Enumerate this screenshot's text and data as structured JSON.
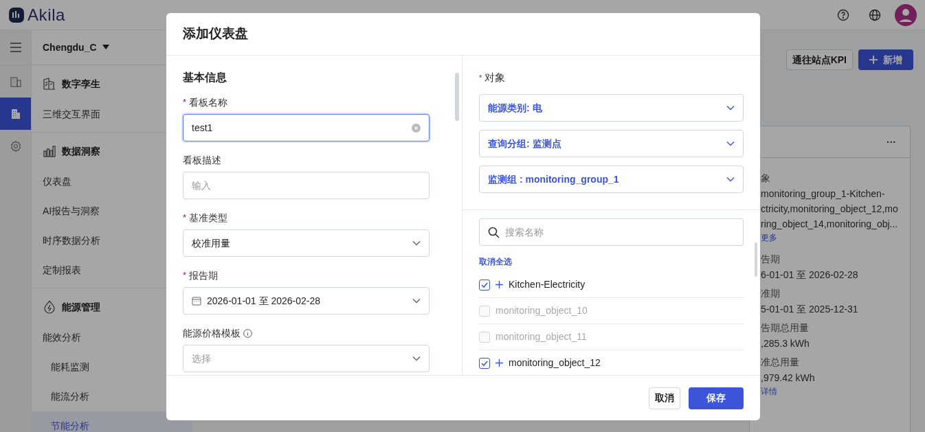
{
  "header": {
    "logo": "Akila"
  },
  "rail_items": [
    {
      "kind": "building",
      "selected": false
    },
    {
      "kind": "office",
      "selected": true
    },
    {
      "kind": "settings",
      "selected": false
    }
  ],
  "sidebar": {
    "site": "Chengdu_C",
    "groups": [
      {
        "title": "数字孪生",
        "kind": "twin",
        "items": [
          {
            "label": "三维交互界面",
            "selected": false
          }
        ]
      },
      {
        "title": "数据洞察",
        "kind": "chart",
        "items": [
          {
            "label": "仪表盘",
            "selected": false
          },
          {
            "label": "AI报告与洞察",
            "selected": false
          },
          {
            "label": "时序数据分析",
            "selected": false
          },
          {
            "label": "定制报表",
            "selected": false
          }
        ]
      },
      {
        "title": "能源管理",
        "kind": "energy",
        "items": [
          {
            "label": "能效分析",
            "selected": false,
            "children": [
              {
                "label": "能耗监测",
                "selected": false
              },
              {
                "label": "能流分析",
                "selected": false
              },
              {
                "label": "节能分析",
                "selected": true
              }
            ]
          }
        ]
      }
    ]
  },
  "toolbar": [
    {
      "label": "通往站点KPI",
      "kind": "secondary"
    },
    {
      "label": "新增",
      "kind": "primary"
    }
  ],
  "card": {
    "menu": "···",
    "lines": [
      {
        "text": "象",
        "kind": "label"
      },
      {
        "text": "monitoring_group_1-Kitchen-",
        "kind": "value"
      },
      {
        "text": "ctricity,monitoring_object_12,mo",
        "kind": "value"
      },
      {
        "text": "ring_object_14,monitoring_obj...",
        "kind": "value"
      },
      {
        "text": "更多",
        "kind": "link"
      },
      {
        "text": "告期",
        "kind": "label"
      },
      {
        "text": "6-01-01 至 2026-02-28",
        "kind": "value"
      },
      {
        "text": "准期",
        "kind": "label"
      },
      {
        "text": "5-01-01 至 2025-12-31",
        "kind": "value"
      },
      {
        "text": "告期总用量",
        "kind": "label"
      },
      {
        "text": ",285.3 kWh",
        "kind": "value"
      },
      {
        "text": "准总用量",
        "kind": "label"
      },
      {
        "text": ",979.42 kWh",
        "kind": "value"
      },
      {
        "text": "详情",
        "kind": "link"
      }
    ]
  },
  "dialog": {
    "title": "添加仪表盘",
    "section": "基本信息",
    "required_mark": "*",
    "fields": [
      {
        "label": "看板名称",
        "required": true,
        "kind": "text",
        "value": "test1",
        "focused": true
      },
      {
        "label": "看板描述",
        "required": false,
        "kind": "text",
        "placeholder": "输入",
        "focused": false
      },
      {
        "label": "基准类型",
        "required": true,
        "kind": "select",
        "value": "校准用量"
      },
      {
        "label": "报告期",
        "required": true,
        "kind": "date",
        "value": "2026-01-01 至 2026-02-28"
      },
      {
        "label": "能源价格模板",
        "required": false,
        "kind": "select",
        "placeholder": "选择",
        "info": true
      }
    ],
    "objects": {
      "label": "对象",
      "required": true,
      "filters": [
        "能源类别: 电",
        "查询分组: 监测点",
        "监测组 : monitoring_group_1"
      ],
      "search_placeholder": "搜索名称",
      "deselect_all": "取消全选",
      "items": [
        {
          "label": "Kitchen-Electricity",
          "checked": true
        },
        {
          "label": "monitoring_object_10",
          "checked": false
        },
        {
          "label": "monitoring_object_11",
          "checked": false
        },
        {
          "label": "monitoring_object_12",
          "checked": true
        }
      ]
    },
    "buttons": [
      {
        "label": "取消",
        "kind": "secondary"
      },
      {
        "label": "保存",
        "kind": "primary"
      }
    ]
  }
}
